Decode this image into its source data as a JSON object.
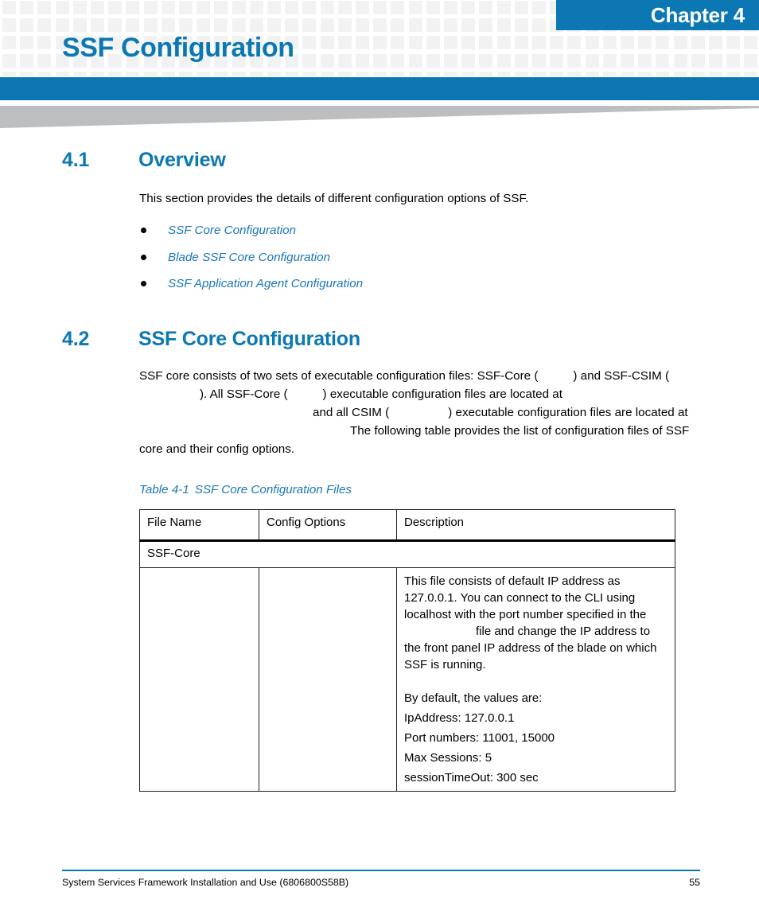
{
  "header": {
    "chapter_badge": "Chapter 4",
    "chapter_title": "SSF Configuration",
    "accent_color": "#0b78b4",
    "grid_square_color": "#f2f2f2",
    "wedge_color": "#bcbec0"
  },
  "sections": {
    "overview": {
      "number": "4.1",
      "title": "Overview",
      "intro": "This section provides the details of different configuration options of SSF.",
      "links": [
        "SSF Core Configuration",
        "Blade SSF Core Configuration",
        "SSF Application Agent Configuration"
      ]
    },
    "ssf_core": {
      "number": "4.2",
      "title": "SSF Core Configuration",
      "paragraph_parts": {
        "p1": "SSF core consists of two sets of executable configuration files: SSF-Core (",
        "p2": ") and SSF-CSIM (",
        "p3": "). All SSF-Core (",
        "p4": ") executable configuration files are located at",
        "p5": "and all CSIM (",
        "p6": ") executable configuration files are located at",
        "p7": "The following table provides the list of configuration files of SSF core and their config options."
      }
    }
  },
  "table": {
    "caption_number": "Table 4-1",
    "caption_text": "SSF Core Configuration Files",
    "headers": [
      "File Name",
      "Config Options",
      "Description"
    ],
    "group_row_label": "SSF-Core",
    "rows": [
      {
        "file_name": "",
        "config_options": "",
        "description_blocks": [
          "This file consists of default IP address as 127.0.0.1. You can connect to the CLI using localhost with the port number specified in the",
          "file and change the IP address to the front panel IP address of the blade on which SSF is running.",
          "By default, the values are:",
          "IpAddress: 127.0.0.1",
          "Port numbers: 11001, 15000",
          "Max Sessions: 5",
          "sessionTimeOut: 300 sec"
        ]
      }
    ]
  },
  "footer": {
    "document_title": "System Services Framework Installation and Use (6806800S58B)",
    "page_number": "55"
  }
}
